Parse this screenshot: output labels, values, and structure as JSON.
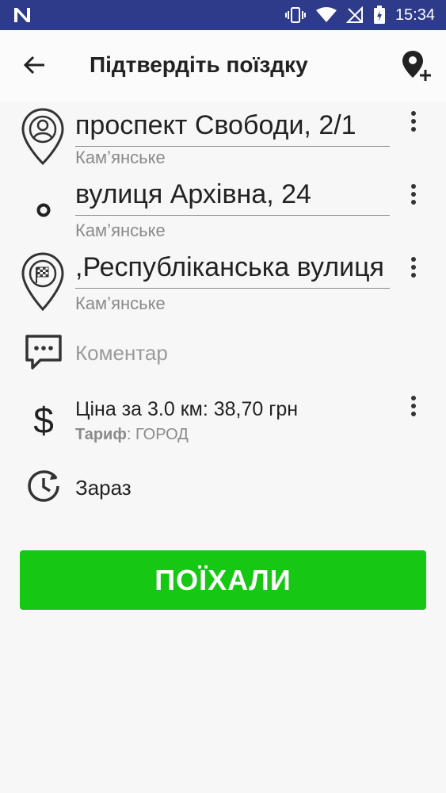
{
  "status_bar": {
    "time": "15:34"
  },
  "app_bar": {
    "title": "Підтвердіть поїздку"
  },
  "route": [
    {
      "address": "проспект Свободи, 2/1",
      "city": "Кам’янське",
      "icon": "pickup-pin-icon"
    },
    {
      "address": "вулиця Архівна, 24",
      "city": "Кам’янське",
      "icon": "waypoint-dot-icon"
    },
    {
      "address": "Республіканська вулиця,",
      "city": "Кам’янське",
      "icon": "destination-flag-pin-icon"
    }
  ],
  "comment": {
    "placeholder": "Коментар"
  },
  "price": {
    "text": "Ціна за 3.0 км: 38,70 грн",
    "tariff_label": "Тариф",
    "tariff_value": ": ГОРОД"
  },
  "time": {
    "label": "Зараз"
  },
  "actions": {
    "go_label": "ПОЇХАЛИ"
  },
  "colors": {
    "status_bar": "#2e3a8a",
    "go_button": "#16c813"
  }
}
